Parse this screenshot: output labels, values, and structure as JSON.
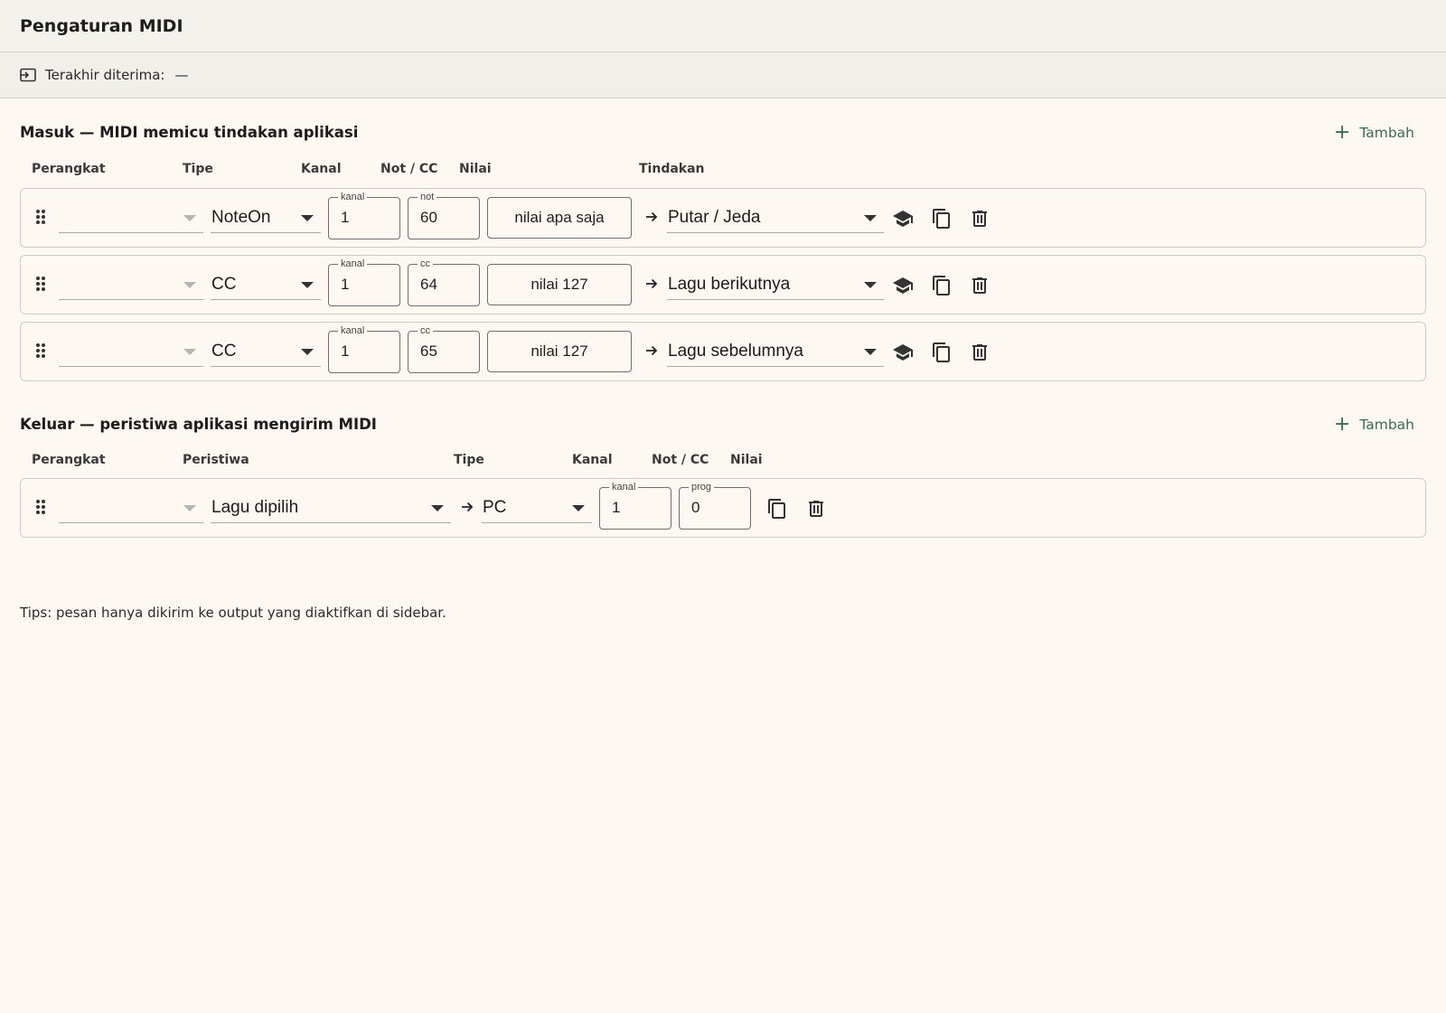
{
  "header": {
    "title": "Pengaturan MIDI"
  },
  "status": {
    "icon": "input-icon",
    "label": "Terakhir diterima:",
    "value": "—"
  },
  "incoming": {
    "title": "Masuk — MIDI memicu tindakan aplikasi",
    "add_label": "Tambah",
    "columns": [
      "Perangkat",
      "Tipe",
      "Kanal",
      "Not / CC",
      "Nilai",
      "Tindakan"
    ],
    "rows": [
      {
        "device": "",
        "type": "NoteOn",
        "channel_label": "kanal",
        "channel": "1",
        "note_label": "not",
        "note": "60",
        "value": "nilai apa saja",
        "action": "Putar / Jeda"
      },
      {
        "device": "",
        "type": "CC",
        "channel_label": "kanal",
        "channel": "1",
        "note_label": "cc",
        "note": "64",
        "value": "nilai 127",
        "action": "Lagu berikutnya"
      },
      {
        "device": "",
        "type": "CC",
        "channel_label": "kanal",
        "channel": "1",
        "note_label": "cc",
        "note": "65",
        "value": "nilai 127",
        "action": "Lagu sebelumnya"
      }
    ]
  },
  "outgoing": {
    "title": "Keluar — peristiwa aplikasi mengirim MIDI",
    "add_label": "Tambah",
    "columns": [
      "Perangkat",
      "Peristiwa",
      "Tipe",
      "Kanal",
      "Not / CC",
      "Nilai"
    ],
    "rows": [
      {
        "device": "",
        "event": "Lagu dipilih",
        "type": "PC",
        "channel_label": "kanal",
        "channel": "1",
        "prog_label": "prog",
        "prog": "0"
      }
    ]
  },
  "tips": "Tips: pesan hanya dikirim ke output yang diaktifkan di sidebar.",
  "colors": {
    "accent": "#3b6b52",
    "background": "#fdf8f2",
    "header": "#f4f2ec"
  }
}
